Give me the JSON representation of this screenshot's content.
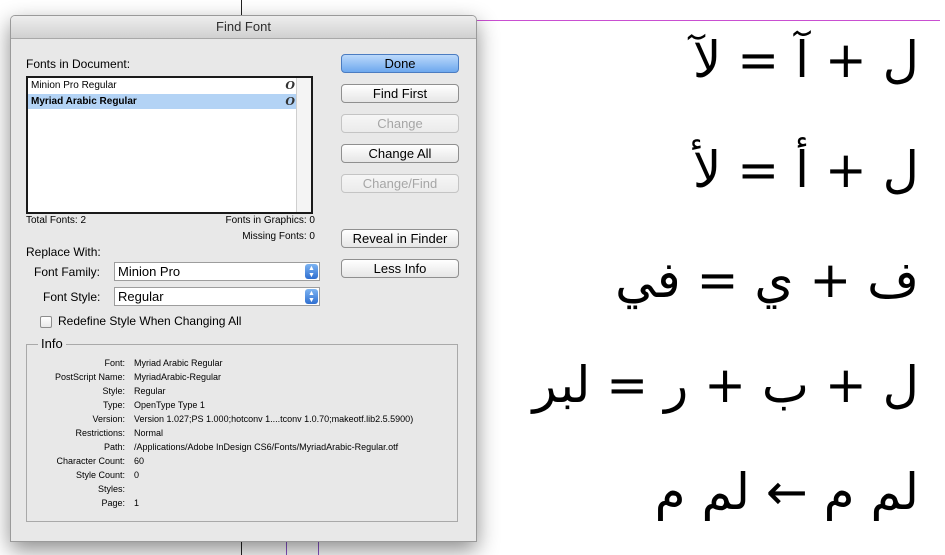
{
  "dialog": {
    "title": "Find Font",
    "fonts_in_document_label": "Fonts in Document:",
    "font_list": [
      {
        "name": "Minion Pro Regular",
        "selected": false,
        "icon": "opentype-icon"
      },
      {
        "name": "Myriad Arabic Regular",
        "selected": true,
        "icon": "opentype-icon"
      }
    ],
    "total_fonts": "Total Fonts: 2",
    "fonts_in_graphics": "Fonts in Graphics: 0",
    "missing_fonts": "Missing Fonts: 0",
    "buttons": {
      "done": "Done",
      "find_first": "Find First",
      "change": "Change",
      "change_all": "Change All",
      "change_find": "Change/Find",
      "reveal_in_finder": "Reveal in Finder",
      "less_info": "Less Info"
    },
    "replace_with_label": "Replace With:",
    "font_family_label": "Font Family:",
    "font_family_value": "Minion Pro",
    "font_style_label": "Font Style:",
    "font_style_value": "Regular",
    "redefine_label": "Redefine Style When Changing All",
    "redefine_checked": false,
    "info": {
      "title": "Info",
      "rows": [
        {
          "key": "Font:",
          "value": "Myriad Arabic Regular"
        },
        {
          "key": "PostScript Name:",
          "value": "MyriadArabic-Regular"
        },
        {
          "key": "Style:",
          "value": "Regular"
        },
        {
          "key": "Type:",
          "value": "OpenType Type 1"
        },
        {
          "key": "Version:",
          "value": "Version 1.027;PS 1.000;hotconv 1....tconv 1.0.70;makeotf.lib2.5.5900)"
        },
        {
          "key": "Restrictions:",
          "value": "Normal"
        },
        {
          "key": "Path:",
          "value": "/Applications/Adobe InDesign CS6/Fonts/MyriadArabic-Regular.otf"
        },
        {
          "key": "Character Count:",
          "value": "60"
        },
        {
          "key": "Style Count:",
          "value": "0"
        },
        {
          "key": "Styles:",
          "value": ""
        },
        {
          "key": "Page:",
          "value": "1"
        }
      ]
    }
  },
  "document": {
    "lines": [
      "ل + آ = لآ",
      "ل + أ = لأ",
      "ف + ي = في",
      "ل + ب + ر = لبر",
      "لم م ← لم م"
    ]
  },
  "colors": {
    "selection": "#b3d3f5",
    "default_button": "#6ea8ee",
    "page_edge": "#c94fd1"
  }
}
